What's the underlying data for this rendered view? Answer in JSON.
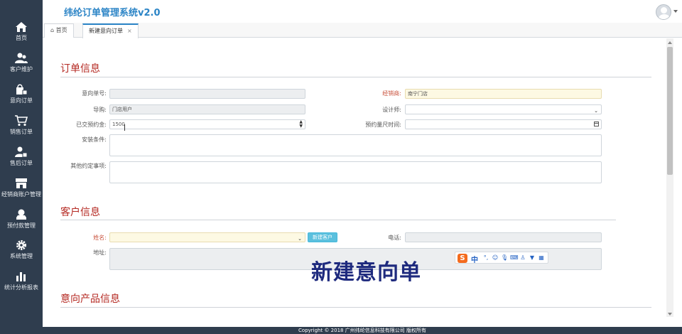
{
  "app": {
    "title": "纬纶订单管理系统v2.0"
  },
  "sidebar": {
    "items": [
      {
        "label": "首页",
        "icon": "home-icon"
      },
      {
        "label": "客户维护",
        "icon": "users-icon"
      },
      {
        "label": "意向订单",
        "icon": "intent-order-icon"
      },
      {
        "label": "销售订单",
        "icon": "cart-icon"
      },
      {
        "label": "售后订单",
        "icon": "after-sales-icon"
      },
      {
        "label": "经销商账户管理",
        "icon": "store-icon"
      },
      {
        "label": "预付款管理",
        "icon": "prepay-icon"
      },
      {
        "label": "系统管理",
        "icon": "gear-icon"
      },
      {
        "label": "统计分析报表",
        "icon": "bar-chart-icon"
      }
    ]
  },
  "tabs": [
    {
      "label": "首页",
      "icon": "home-icon"
    },
    {
      "label": "新建意向订单",
      "close": "×"
    }
  ],
  "order_section": {
    "title": "订单信息",
    "intent_no": {
      "label": "意向单号:",
      "value": ""
    },
    "dealer": {
      "label": "经销商:",
      "value": "南宁门店"
    },
    "guide": {
      "label": "导购:",
      "value": "门店用户"
    },
    "designer": {
      "label": "设计师:",
      "value": ""
    },
    "deposit": {
      "label": "已交预约金:",
      "value": "1500"
    },
    "measure_time": {
      "label": "预约量尺时间:",
      "value": ""
    },
    "install": {
      "label": "安装条件:",
      "value": ""
    },
    "other": {
      "label": "其他约定事项:",
      "value": ""
    }
  },
  "customer_section": {
    "title": "客户信息",
    "name": {
      "label": "姓名:",
      "value": ""
    },
    "new_customer_button": "新建客户",
    "phone": {
      "label": "电话:",
      "value": ""
    },
    "address": {
      "label": "地址:",
      "value": ""
    }
  },
  "product_section": {
    "title": "意向产品信息"
  },
  "overlay_caption": "新建意向单",
  "ime": {
    "logo": "S",
    "mode": "中",
    "icons": [
      "punct-icon",
      "emoji-icon",
      "mic-icon",
      "keyboard-icon",
      "user-icon",
      "shirt-icon",
      "grid-icon"
    ]
  },
  "footer": {
    "text": "Copyright © 2018 广州纬纶信息科技有限公司 版权所有"
  },
  "colors": {
    "sidebar": "#2f3d4e",
    "accent": "#2b84c6",
    "section_title": "#b52a23",
    "required_label": "#c9533e"
  }
}
